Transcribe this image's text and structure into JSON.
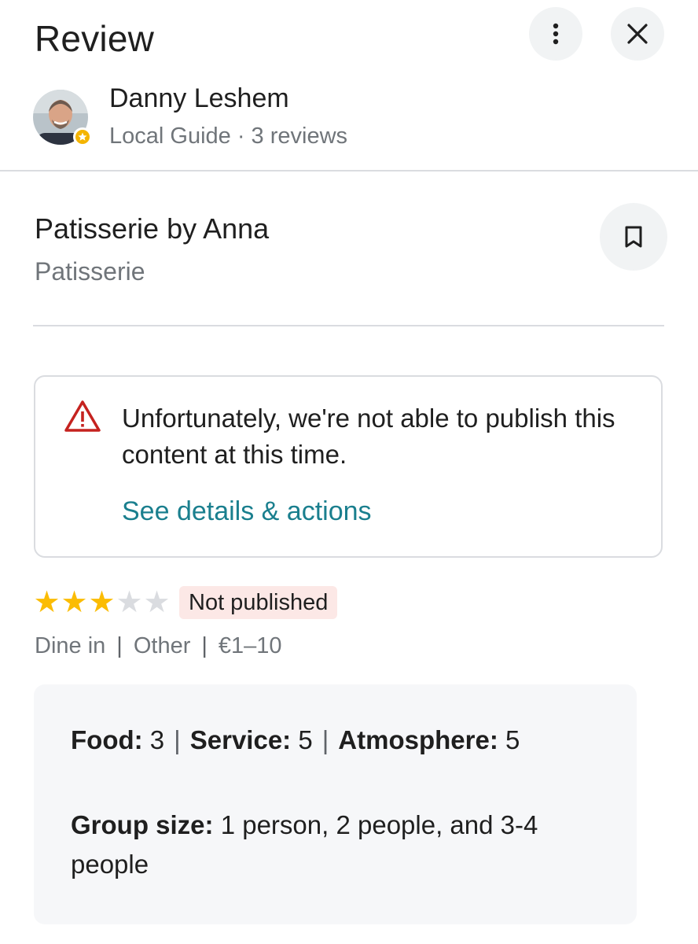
{
  "header": {
    "title": "Review"
  },
  "icons": {
    "more": "more-vert-icon",
    "close": "close-icon",
    "bookmark": "bookmark-icon",
    "warning": "warning-triangle-icon",
    "local_guide_badge": "star-badge-icon"
  },
  "reviewer": {
    "name": "Danny Leshem",
    "meta": "Local Guide · 3 reviews"
  },
  "place": {
    "name": "Patisserie by Anna",
    "category": "Patisserie"
  },
  "warning": {
    "message": "Unfortunately, we're not able to publish this content at this time.",
    "link": "See details & actions"
  },
  "rating": {
    "stars": 3,
    "max": 5,
    "status": "Not published"
  },
  "visit": {
    "items": [
      "Dine in",
      "Other",
      "€1–10"
    ],
    "separator": "|"
  },
  "details": {
    "food_label": "Food:",
    "food_value": "3",
    "service_label": "Service:",
    "service_value": "5",
    "atmosphere_label": "Atmosphere:",
    "atmosphere_value": "5",
    "separator": "|",
    "group_label": "Group size:",
    "group_value": "1 person, 2 people, and 3-4 people"
  },
  "colors": {
    "accent_link": "#1a7f8e",
    "star": "#fbbc04",
    "warning": "#c5221f",
    "badge_bg": "#fce8e6"
  }
}
